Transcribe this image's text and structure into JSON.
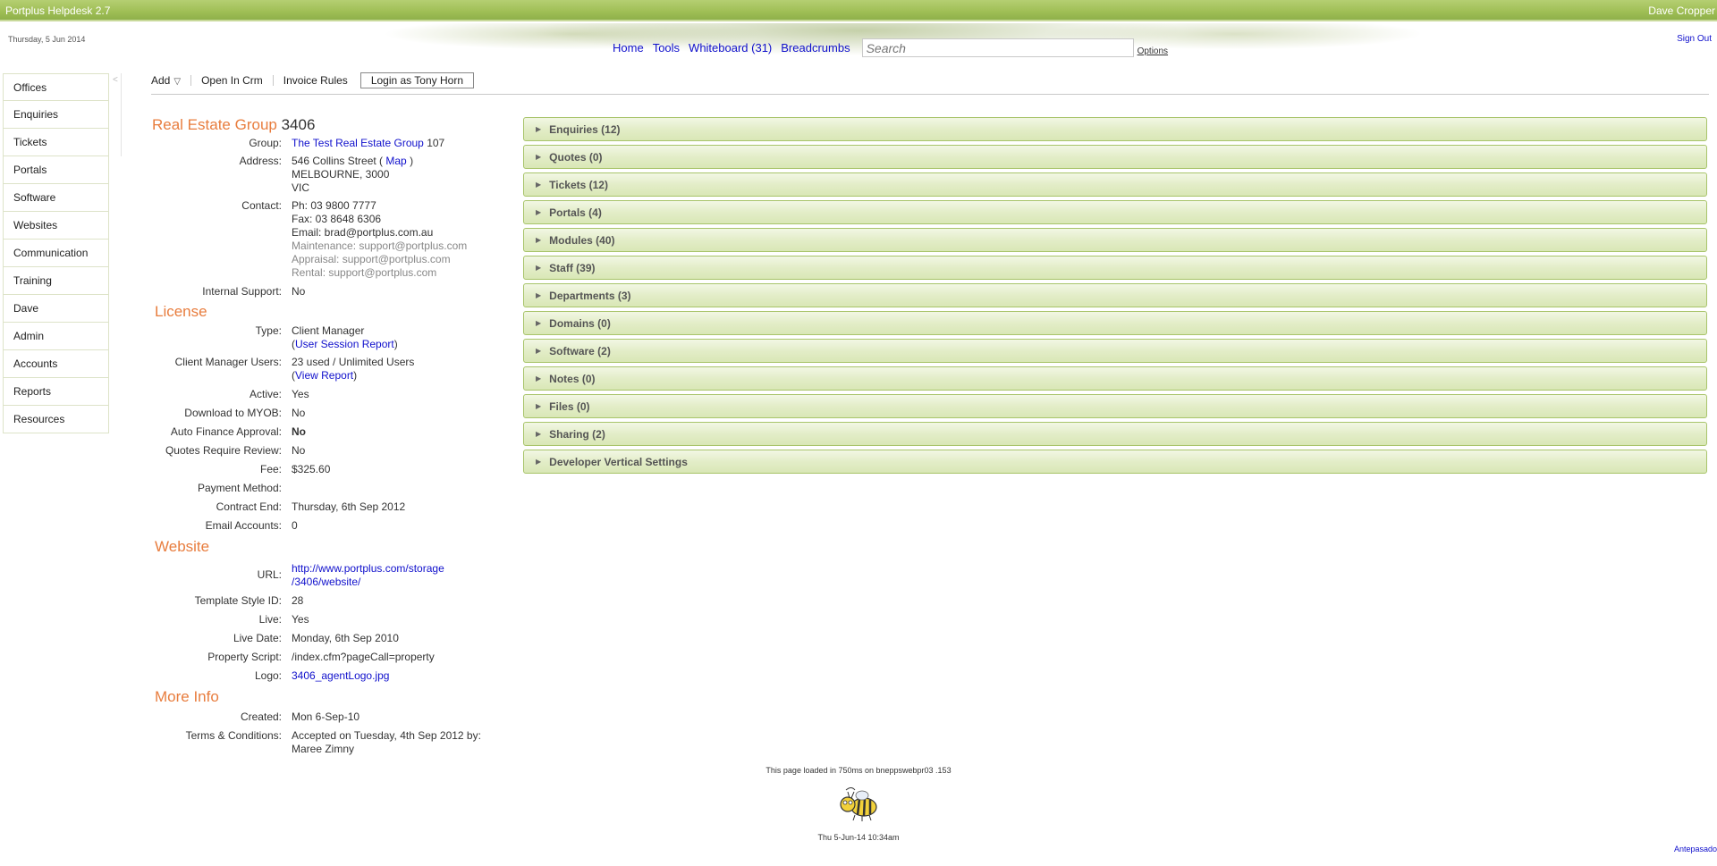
{
  "header": {
    "app_title": "Portplus Helpdesk 2.7",
    "user_name": "Dave Cropper",
    "date": "Thursday, 5 Jun 2014",
    "sign_out": "Sign Out",
    "nav": {
      "home": "Home",
      "tools": "Tools",
      "whiteboard": "Whiteboard (31)",
      "breadcrumbs": "Breadcrumbs",
      "search_placeholder": "Search",
      "options": "Options"
    }
  },
  "sidebar": {
    "items": [
      "Offices",
      "Enquiries",
      "Tickets",
      "Portals",
      "Software",
      "Websites",
      "Communication",
      "Training",
      "Dave",
      "Admin",
      "Accounts",
      "Reports",
      "Resources"
    ]
  },
  "toolbar": {
    "add": "Add",
    "open_in_crm": "Open In Crm",
    "invoice_rules": "Invoice Rules",
    "login_as": "Login as Tony Horn"
  },
  "company": {
    "name": "Real Estate Group",
    "id": "3406",
    "group_label": "Group:",
    "group_link": "The Test Real Estate Group",
    "group_id": "107",
    "address_label": "Address:",
    "address_line1": "546 Collins Street (",
    "map_link": "Map",
    "address_line1_end": ")",
    "address_line2": "MELBOURNE, 3000",
    "address_line3": "VIC",
    "contact_label": "Contact:",
    "phone": "Ph: 03 9800 7777",
    "fax": "Fax: 03 8648 6306",
    "email": "Email: brad@portplus.com.au",
    "maintenance": "Maintenance: support@portplus.com",
    "appraisal": "Appraisal: support@portplus.com",
    "rental": "Rental: support@portplus.com",
    "internal_support_label": "Internal Support:",
    "internal_support": "No"
  },
  "license": {
    "title": "License",
    "type_label": "Type:",
    "type": "Client Manager",
    "session_open": "(",
    "session_report": "User Session Report",
    "session_close": ")",
    "users_label": "Client Manager Users:",
    "users": "23 used / Unlimited Users",
    "view_open": "(",
    "view_report": "View Report",
    "view_close": ")",
    "active_label": "Active:",
    "active": "Yes",
    "myob_label": "Download to MYOB:",
    "myob": "No",
    "auto_finance_label": "Auto Finance Approval:",
    "auto_finance": "No",
    "quotes_review_label": "Quotes Require Review:",
    "quotes_review": "No",
    "fee_label": "Fee:",
    "fee": "$325.60",
    "payment_method_label": "Payment Method:",
    "payment_method": "",
    "contract_end_label": "Contract End:",
    "contract_end": "Thursday, 6th Sep 2012",
    "email_accounts_label": "Email Accounts:",
    "email_accounts": "0"
  },
  "website": {
    "title": "Website",
    "url_label": "URL:",
    "url_line1": "http://www.portplus.com/storage",
    "url_line2": "/3406/website/",
    "template_label": "Template Style ID:",
    "template": "28",
    "live_label": "Live:",
    "live": "Yes",
    "live_date_label": "Live Date:",
    "live_date": "Monday, 6th Sep 2010",
    "property_script_label": "Property Script:",
    "property_script": "/index.cfm?pageCall=property",
    "logo_label": "Logo:",
    "logo": "3406_agentLogo.jpg"
  },
  "more_info": {
    "title": "More Info",
    "created_label": "Created:",
    "created": "Mon 6-Sep-10",
    "terms_label": "Terms & Conditions:",
    "terms_line1": "Accepted on Tuesday, 4th Sep 2012 by:",
    "terms_line2": "Maree Zimny"
  },
  "accordion": [
    "Enquiries (12)",
    "Quotes (0)",
    "Tickets (12)",
    "Portals (4)",
    "Modules (40)",
    "Staff (39)",
    "Departments (3)",
    "Domains (0)",
    "Software (2)",
    "Notes (0)",
    "Files (0)",
    "Sharing (2)",
    "Developer Vertical Settings"
  ],
  "footer": {
    "load_text": "This page loaded in 750ms on bneppswebpr03 .153",
    "timestamp": "Thu 5-Jun-14 10:34am",
    "corner_link": "Antepasado"
  },
  "colors": {
    "topbar": "#9fbe55",
    "section_title": "#e87d3e",
    "link": "#1010cc",
    "accordion_border": "#a8c46a"
  }
}
